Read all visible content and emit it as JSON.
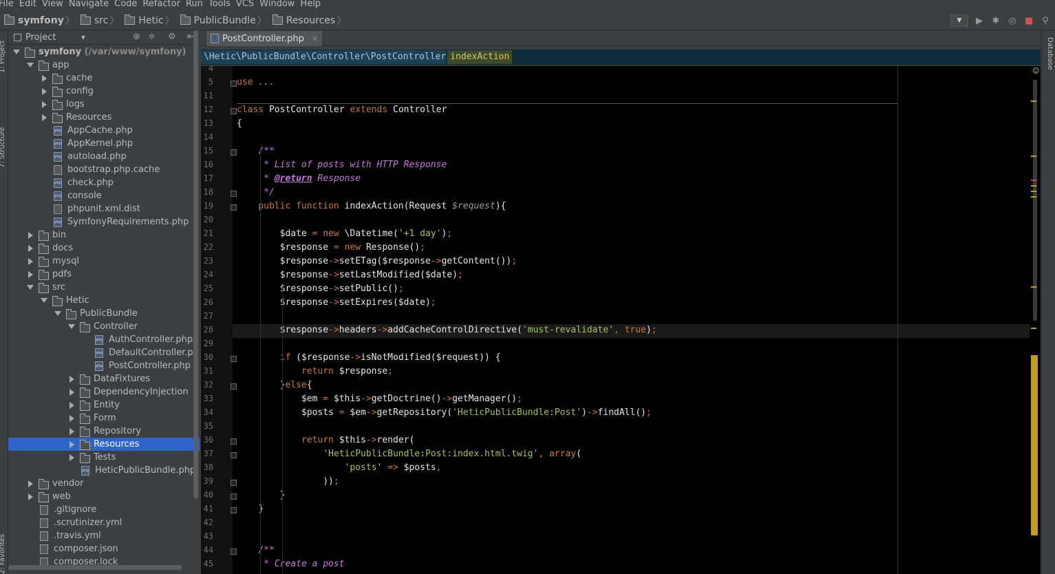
{
  "menu": [
    "File",
    "Edit",
    "View",
    "Navigate",
    "Code",
    "Refactor",
    "Run",
    "Tools",
    "VCS",
    "Window",
    "Help"
  ],
  "breadcrumb": [
    "symfony",
    "src",
    "Hetic",
    "PublicBundle",
    "Resources"
  ],
  "project_panel": {
    "title": "Project"
  },
  "tree": [
    {
      "label": "symfony",
      "sub": " (/var/www/symfony)",
      "depth": 0,
      "arrow": "open",
      "icon": "folder",
      "bold": true
    },
    {
      "label": "app",
      "depth": 1,
      "arrow": "open",
      "icon": "folder"
    },
    {
      "label": "cache",
      "depth": 2,
      "arrow": "closed",
      "icon": "folder"
    },
    {
      "label": "config",
      "depth": 2,
      "arrow": "closed",
      "icon": "folder"
    },
    {
      "label": "logs",
      "depth": 2,
      "arrow": "closed",
      "icon": "folder"
    },
    {
      "label": "Resources",
      "depth": 2,
      "arrow": "closed",
      "icon": "folder"
    },
    {
      "label": "AppCache.php",
      "depth": 2,
      "arrow": "none",
      "icon": "php"
    },
    {
      "label": "AppKernel.php",
      "depth": 2,
      "arrow": "none",
      "icon": "php"
    },
    {
      "label": "autoload.php",
      "depth": 2,
      "arrow": "none",
      "icon": "php"
    },
    {
      "label": "bootstrap.php.cache",
      "depth": 2,
      "arrow": "none",
      "icon": "file"
    },
    {
      "label": "check.php",
      "depth": 2,
      "arrow": "none",
      "icon": "php"
    },
    {
      "label": "console",
      "depth": 2,
      "arrow": "none",
      "icon": "php"
    },
    {
      "label": "phpunit.xml.dist",
      "depth": 2,
      "arrow": "none",
      "icon": "file"
    },
    {
      "label": "SymfonyRequirements.php",
      "depth": 2,
      "arrow": "none",
      "icon": "php"
    },
    {
      "label": "bin",
      "depth": 1,
      "arrow": "closed",
      "icon": "folder"
    },
    {
      "label": "docs",
      "depth": 1,
      "arrow": "closed",
      "icon": "folder"
    },
    {
      "label": "mysql",
      "depth": 1,
      "arrow": "closed",
      "icon": "folder"
    },
    {
      "label": "pdfs",
      "depth": 1,
      "arrow": "closed",
      "icon": "folder"
    },
    {
      "label": "src",
      "depth": 1,
      "arrow": "open",
      "icon": "folder"
    },
    {
      "label": "Hetic",
      "depth": 2,
      "arrow": "open",
      "icon": "folder"
    },
    {
      "label": "PublicBundle",
      "depth": 3,
      "arrow": "open",
      "icon": "folder"
    },
    {
      "label": "Controller",
      "depth": 4,
      "arrow": "open",
      "icon": "folder"
    },
    {
      "label": "AuthController.php",
      "depth": 5,
      "arrow": "none",
      "icon": "php"
    },
    {
      "label": "DefaultController.ph",
      "depth": 5,
      "arrow": "none",
      "icon": "php"
    },
    {
      "label": "PostController.php",
      "depth": 5,
      "arrow": "none",
      "icon": "php"
    },
    {
      "label": "DataFixtures",
      "depth": 4,
      "arrow": "closed",
      "icon": "folder"
    },
    {
      "label": "DependencyInjection",
      "depth": 4,
      "arrow": "closed",
      "icon": "folder"
    },
    {
      "label": "Entity",
      "depth": 4,
      "arrow": "closed",
      "icon": "folder"
    },
    {
      "label": "Form",
      "depth": 4,
      "arrow": "closed",
      "icon": "folder"
    },
    {
      "label": "Repository",
      "depth": 4,
      "arrow": "closed",
      "icon": "folder"
    },
    {
      "label": "Resources",
      "depth": 4,
      "arrow": "closed",
      "icon": "folder",
      "selected": true
    },
    {
      "label": "Tests",
      "depth": 4,
      "arrow": "closed",
      "icon": "folder"
    },
    {
      "label": "HeticPublicBundle.php",
      "depth": 4,
      "arrow": "none",
      "icon": "php"
    },
    {
      "label": "vendor",
      "depth": 1,
      "arrow": "closed",
      "icon": "folder"
    },
    {
      "label": "web",
      "depth": 1,
      "arrow": "closed",
      "icon": "folder"
    },
    {
      "label": ".gitignore",
      "depth": 1,
      "arrow": "none",
      "icon": "file"
    },
    {
      "label": ".scrutinizer.yml",
      "depth": 1,
      "arrow": "none",
      "icon": "file"
    },
    {
      "label": ".travis.yml",
      "depth": 1,
      "arrow": "none",
      "icon": "file"
    },
    {
      "label": "composer.json",
      "depth": 1,
      "arrow": "none",
      "icon": "file"
    },
    {
      "label": "composer.lock",
      "depth": 1,
      "arrow": "none",
      "icon": "file"
    }
  ],
  "editor_tab": {
    "label": "PostController.php"
  },
  "editor_breadcrumb": {
    "path": "\\Hetic\\PublicBundle\\Controller\\PostController",
    "method": "indexAction"
  },
  "side_tabs": {
    "left_top": "1: Project",
    "left_mid": "7: Structure",
    "left_bottom": "2: Favorites",
    "right": "Database"
  },
  "code_lines": [
    {
      "n": "4",
      "html": ""
    },
    {
      "n": "5",
      "html": "<span class='k'>use</span> <span class='p'>...</span>",
      "fold": true
    },
    {
      "n": "11",
      "html": ""
    },
    {
      "n": "12",
      "html": "<span class='k'>class</span> PostController <span class='k'>extends</span> Controller",
      "fold": true
    },
    {
      "n": "13",
      "html": "{"
    },
    {
      "n": "14",
      "html": ""
    },
    {
      "n": "15",
      "html": "    <span class='cm'>/**</span>",
      "fold": true
    },
    {
      "n": "16",
      "html": "<span class='cm'>     * List of posts with HTTP Response</span>"
    },
    {
      "n": "17",
      "html": "<span class='cm'>     * </span><span class='cmt'>@return</span><span class='cm'> Response</span>"
    },
    {
      "n": "18",
      "html": "<span class='cm'>     */</span>",
      "fold": true
    },
    {
      "n": "19",
      "html": "    <span class='k'>public function</span> indexAction(Request <span class='p'>$request</span>){",
      "fold": true
    },
    {
      "n": "20",
      "html": ""
    },
    {
      "n": "21",
      "html": "        $date <span class='op'>=</span> <span class='k'>new</span> \\Datetime(<span class='sg'>'+1 day'</span>)<span class='op'>;</span>"
    },
    {
      "n": "22",
      "html": "        $response <span class='op'>=</span> <span class='k'>new</span> Response()<span class='op'>;</span>"
    },
    {
      "n": "23",
      "html": "        $response<span class='op'>-&gt;</span>setETag($response<span class='op'>-&gt;</span>getContent())<span class='op'>;</span>"
    },
    {
      "n": "24",
      "html": "        $response<span class='op'>-&gt;</span>setLastModified($date)<span class='op'>;</span>"
    },
    {
      "n": "25",
      "html": "        $response<span class='op'>-&gt;</span>setPublic()<span class='op'>;</span>"
    },
    {
      "n": "26",
      "html": "        $response<span class='op'>-&gt;</span>setExpires($date)<span class='op'>;</span>"
    },
    {
      "n": "27",
      "html": ""
    },
    {
      "n": "28",
      "html": "        $response<span class='op'>-&gt;</span>headers<span class='op'>-&gt;</span>addCacheControlDirective(<span class='sg'>'must-revalidate'</span><span class='op'>,</span> <span class='k'>true</span>)<span class='op'>;</span>",
      "current": true
    },
    {
      "n": "29",
      "html": ""
    },
    {
      "n": "30",
      "html": "        <span class='k'>if</span> ($response<span class='op'>-&gt;</span>isNotModified($request)) {",
      "fold": true
    },
    {
      "n": "31",
      "html": "            <span class='k'>return</span> $response<span class='op'>;</span>"
    },
    {
      "n": "32",
      "html": "        }<span class='k'>else</span>{",
      "fold": true
    },
    {
      "n": "33",
      "html": "            $em <span class='op'>=</span> $this<span class='op'>-&gt;</span>getDoctrine()<span class='op'>-&gt;</span>getManager()<span class='op'>;</span>"
    },
    {
      "n": "34",
      "html": "            $posts <span class='op'>=</span> $em<span class='op'>-&gt;</span>getRepository(<span class='sg'>'HeticPublicBundle:Post'</span>)<span class='op'>-&gt;</span>findAll()<span class='op'>;</span>"
    },
    {
      "n": "35",
      "html": ""
    },
    {
      "n": "36",
      "html": "            <span class='k'>return</span> $this<span class='op'>-&gt;</span>render(",
      "fold": true
    },
    {
      "n": "37",
      "html": "                <span class='sg'>'HeticPublicBundle:Post:index.html.twig'</span><span class='op'>,</span> <span class='k'>array</span>(",
      "fold": true
    },
    {
      "n": "38",
      "html": "                    <span class='sg'>'posts'</span> <span class='op'>=&gt;</span> $posts<span class='op'>,</span>"
    },
    {
      "n": "39",
      "html": "                ))<span class='op'>;</span>",
      "fold": true
    },
    {
      "n": "40",
      "html": "        }",
      "fold": true
    },
    {
      "n": "41",
      "html": "    }",
      "fold": true
    },
    {
      "n": "42",
      "html": ""
    },
    {
      "n": "43",
      "html": ""
    },
    {
      "n": "44",
      "html": "    <span class='cm'>/**</span>",
      "fold": true
    },
    {
      "n": "45",
      "html": "<span class='cm'>     * Create a post</span>"
    }
  ]
}
